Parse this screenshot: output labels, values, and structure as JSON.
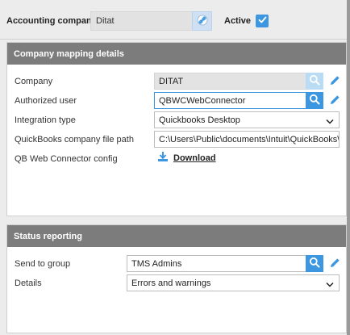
{
  "header": {
    "accounting_company_label": "Accounting company",
    "accounting_company_value": "Ditat",
    "active_label": "Active",
    "active_checked": true
  },
  "mapping": {
    "title": "Company mapping details",
    "company_label": "Company",
    "company_value": "DITAT",
    "authorized_user_label": "Authorized user",
    "authorized_user_value": "QBWCWebConnector",
    "integration_type_label": "Integration type",
    "integration_type_value": "Quickbooks Desktop",
    "file_path_label": "QuickBooks company file path",
    "file_path_value": "C:\\Users\\Public\\documents\\Intuit\\QuickBooks\\Com",
    "config_label": "QB Web Connector config",
    "download_label": "Download"
  },
  "status": {
    "title": "Status reporting",
    "send_to_group_label": "Send to group",
    "send_to_group_value": "TMS Admins",
    "details_label": "Details",
    "details_value": "Errors and warnings"
  },
  "colors": {
    "accent": "#3c97e0",
    "header_bg": "#7c7c7c"
  },
  "icons": [
    "link-icon",
    "checkmark-icon",
    "search-icon",
    "pencil-icon",
    "chevron-down-icon",
    "download-icon"
  ]
}
